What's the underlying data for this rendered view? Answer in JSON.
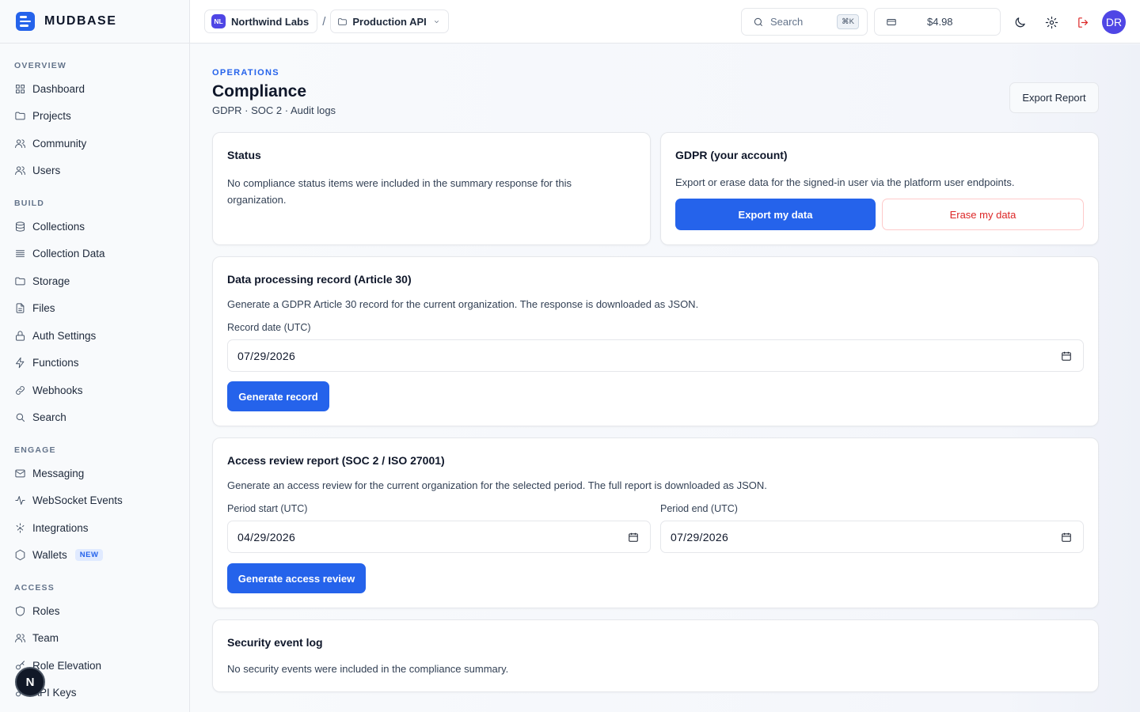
{
  "brand": {
    "name": "MUDBASE"
  },
  "sidebar": {
    "sections": [
      {
        "heading": "OVERVIEW",
        "items": [
          {
            "label": "Dashboard",
            "icon": "grid-icon"
          },
          {
            "label": "Projects",
            "icon": "folder-icon"
          },
          {
            "label": "Community",
            "icon": "users-icon"
          },
          {
            "label": "Users",
            "icon": "users-icon"
          }
        ]
      },
      {
        "heading": "BUILD",
        "items": [
          {
            "label": "Collections",
            "icon": "database-icon"
          },
          {
            "label": "Collection Data",
            "icon": "list-icon"
          },
          {
            "label": "Storage",
            "icon": "folder-icon"
          },
          {
            "label": "Files",
            "icon": "file-icon"
          },
          {
            "label": "Auth Settings",
            "icon": "lock-icon"
          },
          {
            "label": "Functions",
            "icon": "bolt-icon"
          },
          {
            "label": "Webhooks",
            "icon": "link-icon"
          },
          {
            "label": "Search",
            "icon": "search-icon"
          }
        ]
      },
      {
        "heading": "ENGAGE",
        "items": [
          {
            "label": "Messaging",
            "icon": "mail-icon"
          },
          {
            "label": "WebSocket Events",
            "icon": "activity-icon"
          },
          {
            "label": "Integrations",
            "icon": "plug-icon"
          },
          {
            "label": "Wallets",
            "icon": "hexagon-icon",
            "badge": "NEW"
          }
        ]
      },
      {
        "heading": "ACCESS",
        "items": [
          {
            "label": "Roles",
            "icon": "shield-icon"
          },
          {
            "label": "Team",
            "icon": "users-icon"
          },
          {
            "label": "Role Elevation",
            "icon": "key-icon"
          },
          {
            "label": "API Keys",
            "icon": "key-icon"
          }
        ]
      }
    ],
    "floating_badge": "N"
  },
  "topbar": {
    "org_initials": "NL",
    "org_name": "Northwind Labs",
    "separator": "/",
    "project_name": "Production API",
    "search_placeholder": "Search",
    "search_shortcut": "⌘K",
    "balance": "$4.98",
    "avatar_initials": "DR"
  },
  "page": {
    "eyebrow": "OPERATIONS",
    "title": "Compliance",
    "subtitle": "GDPR · SOC 2 · Audit logs",
    "export_report_label": "Export Report"
  },
  "status_card": {
    "title": "Status",
    "message": "No compliance status items were included in the summary response for this organization."
  },
  "gdpr_card": {
    "title": "GDPR (your account)",
    "description": "Export or erase data for the signed-in user via the platform user endpoints.",
    "export_label": "Export my data",
    "erase_label": "Erase my data"
  },
  "dpr_card": {
    "title": "Data processing record (Article 30)",
    "description": "Generate a GDPR Article 30 record for the current organization. The response is downloaded as JSON.",
    "date_label": "Record date (UTC)",
    "date_value": "07/29/2026",
    "button_label": "Generate record"
  },
  "access_card": {
    "title": "Access review report (SOC 2 / ISO 27001)",
    "description": "Generate an access review for the current organization for the selected period. The full report is downloaded as JSON.",
    "start_label": "Period start (UTC)",
    "start_value": "04/29/2026",
    "end_label": "Period end (UTC)",
    "end_value": "07/29/2026",
    "button_label": "Generate access review"
  },
  "security_card": {
    "title": "Security event log",
    "message": "No security events were included in the compliance summary."
  },
  "colors": {
    "accent": "#2563eb",
    "danger": "#dc2626"
  }
}
